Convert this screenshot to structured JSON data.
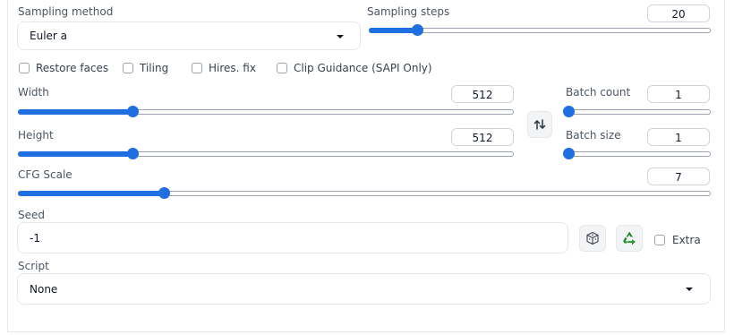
{
  "sampling": {
    "method_label": "Sampling method",
    "method_value": "Euler a",
    "steps_label": "Sampling steps",
    "steps_value": "20",
    "steps_fraction": 0.14
  },
  "options": {
    "restore_faces": "Restore faces",
    "tiling": "Tiling",
    "hires_fix": "Hires. fix",
    "clip_guidance": "Clip Guidance (SAPI Only)",
    "extra": "Extra"
  },
  "width": {
    "label": "Width",
    "value": "512",
    "fraction": 0.23
  },
  "height": {
    "label": "Height",
    "value": "512",
    "fraction": 0.23
  },
  "batch_count": {
    "label": "Batch count",
    "value": "1",
    "fraction": 0.0
  },
  "batch_size": {
    "label": "Batch size",
    "value": "1",
    "fraction": 0.0
  },
  "cfg": {
    "label": "CFG Scale",
    "value": "7",
    "fraction": 0.21
  },
  "seed": {
    "label": "Seed",
    "value": "-1"
  },
  "script": {
    "label": "Script",
    "value": "None"
  },
  "icons": {
    "swap": "swap-dimensions-icon",
    "dice": "dice-icon",
    "recycle": "recycle-icon"
  },
  "colors": {
    "accent": "#1f6fe0"
  }
}
